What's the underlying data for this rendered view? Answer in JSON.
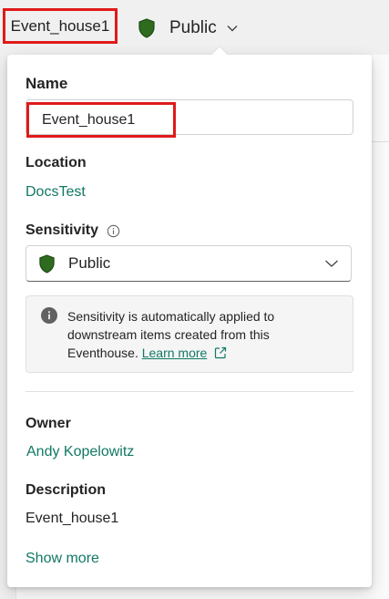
{
  "header": {
    "item_title": "Event_house1",
    "sensitivity_label": "Public"
  },
  "flyout": {
    "name_heading": "Name",
    "name_value": "Event_house1",
    "location_heading": "Location",
    "location_value": "DocsTest",
    "sensitivity_heading": "Sensitivity",
    "sensitivity_value": "Public",
    "info_message": "Sensitivity is automatically applied to downstream items created from this Eventhouse.",
    "learn_more": "Learn more",
    "owner_heading": "Owner",
    "owner_value": "Andy Kopelowitz",
    "description_heading": "Description",
    "description_value": "Event_house1",
    "show_more": "Show more"
  },
  "colors": {
    "highlight": "#e01a1a",
    "link": "#117865",
    "shield": "#2e6b1f"
  },
  "icons": [
    "shield-icon",
    "chevron-down-icon",
    "info-icon",
    "external-link-icon"
  ]
}
